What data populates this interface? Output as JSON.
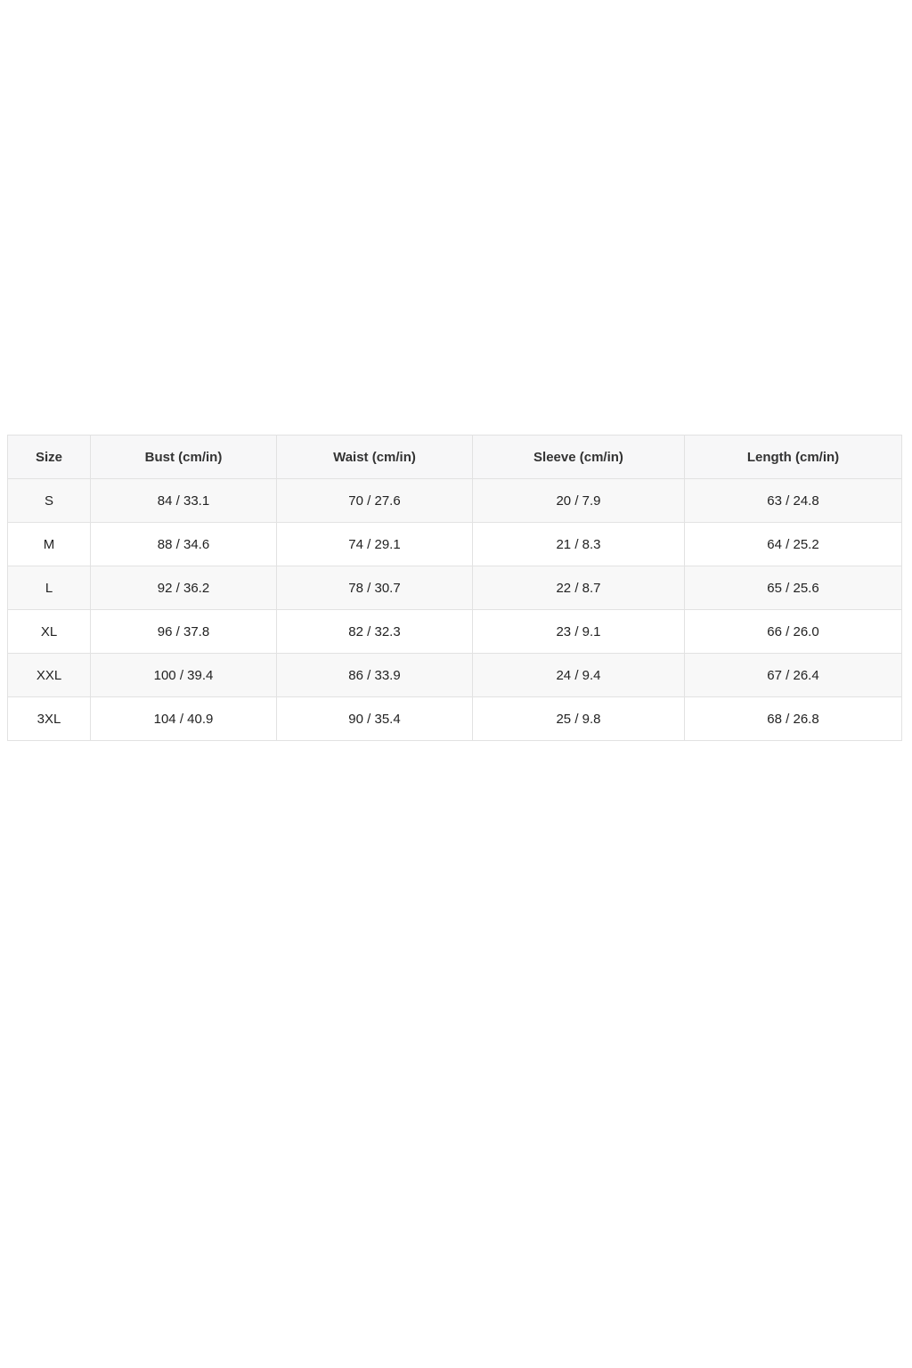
{
  "size_chart": {
    "headers": [
      "Size",
      "Bust (cm/in)",
      "Waist (cm/in)",
      "Sleeve (cm/in)",
      "Length (cm/in)"
    ],
    "rows": [
      [
        "S",
        "84 / 33.1",
        "70 / 27.6",
        "20 / 7.9",
        "63 / 24.8"
      ],
      [
        "M",
        "88 / 34.6",
        "74 / 29.1",
        "21 / 8.3",
        "64 / 25.2"
      ],
      [
        "L",
        "92 / 36.2",
        "78 / 30.7",
        "22 / 8.7",
        "65 / 25.6"
      ],
      [
        "XL",
        "96 / 37.8",
        "82 / 32.3",
        "23 / 9.1",
        "66 / 26.0"
      ],
      [
        "XXL",
        "100 / 39.4",
        "86 / 33.9",
        "24 / 9.4",
        "67 / 26.4"
      ],
      [
        "3XL",
        "104 / 40.9",
        "90 / 35.4",
        "25 / 9.8",
        "68 / 26.8"
      ]
    ]
  },
  "colors": {
    "border": "#e2e2e2",
    "header_bg": "#f7f7f8",
    "row_alt_bg": "#f8f8f8",
    "text": "#222222"
  }
}
